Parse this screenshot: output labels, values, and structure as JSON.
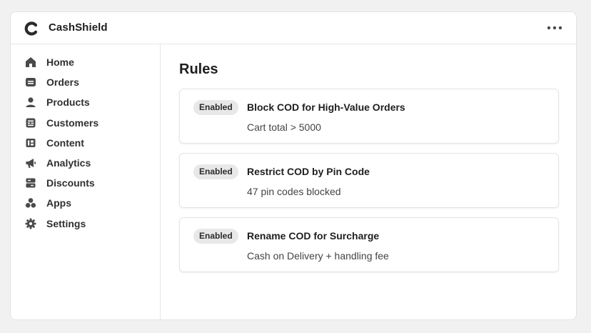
{
  "app": {
    "title": "CashShield"
  },
  "sidebar": {
    "items": [
      {
        "label": "Home",
        "icon": "home-icon"
      },
      {
        "label": "Orders",
        "icon": "orders-icon"
      },
      {
        "label": "Products",
        "icon": "products-icon"
      },
      {
        "label": "Customers",
        "icon": "customers-icon"
      },
      {
        "label": "Content",
        "icon": "content-icon"
      },
      {
        "label": "Analytics",
        "icon": "analytics-icon"
      },
      {
        "label": "Discounts",
        "icon": "discounts-icon"
      },
      {
        "label": "Apps",
        "icon": "apps-icon"
      },
      {
        "label": "Settings",
        "icon": "settings-icon"
      }
    ]
  },
  "main": {
    "title": "Rules",
    "rules": [
      {
        "status": "Enabled",
        "title": "Block COD for High-Value Orders",
        "description": "Cart total > 5000"
      },
      {
        "status": "Enabled",
        "title": "Restrict COD by Pin Code",
        "description": "47 pin codes blocked"
      },
      {
        "status": "Enabled",
        "title": "Rename COD for Surcharge",
        "description": "Cash on Delivery + handling fee"
      }
    ]
  },
  "colors": {
    "icon": "#4a4a4a",
    "badge_bg": "#e8e8e8",
    "border": "#e4e4e4"
  }
}
